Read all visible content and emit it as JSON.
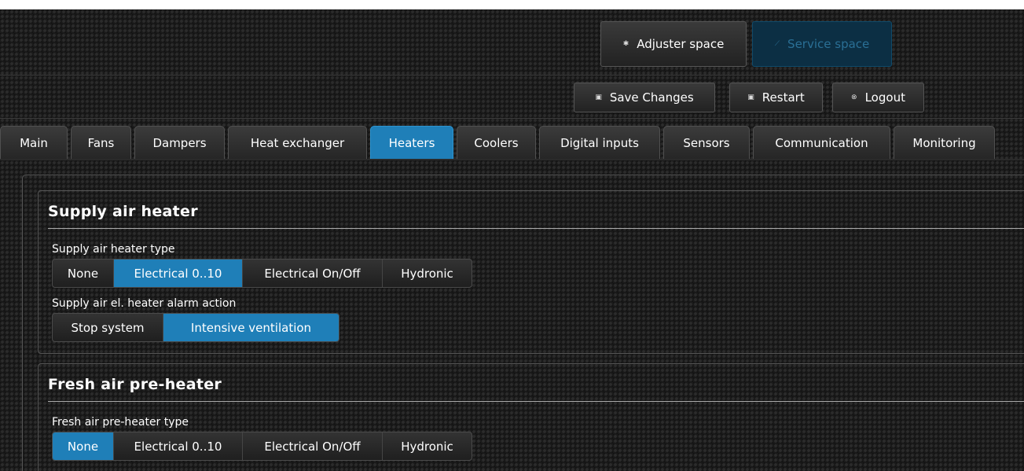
{
  "space_bar": {
    "adjuster": {
      "label": "Adjuster space",
      "icon": "gear-icon"
    },
    "service": {
      "label": "Service space",
      "icon": "wrench-icon"
    }
  },
  "actions": {
    "save": {
      "label": "Save Changes",
      "icon": "save-icon"
    },
    "restart": {
      "label": "Restart",
      "icon": "restart-icon"
    },
    "logout": {
      "label": "Logout",
      "icon": "logout-icon"
    }
  },
  "tabs": [
    {
      "label": "Main"
    },
    {
      "label": "Fans"
    },
    {
      "label": "Dampers"
    },
    {
      "label": "Heat exchanger"
    },
    {
      "label": "Heaters",
      "active": true
    },
    {
      "label": "Coolers"
    },
    {
      "label": "Digital inputs"
    },
    {
      "label": "Sensors"
    },
    {
      "label": "Communication"
    },
    {
      "label": "Monitoring"
    }
  ],
  "supply_heater": {
    "title": "Supply air heater",
    "type_label": "Supply air heater type",
    "type_options": [
      "None",
      "Electrical 0..10",
      "Electrical On/Off",
      "Hydronic"
    ],
    "type_selected": "Electrical 0..10",
    "alarm_label": "Supply air el. heater alarm action",
    "alarm_options": [
      "Stop system",
      "Intensive ventilation"
    ],
    "alarm_selected": "Intensive ventilation"
  },
  "preheater": {
    "title": "Fresh air pre-heater",
    "type_label": "Fresh air pre-heater type",
    "type_options": [
      "None",
      "Electrical 0..10",
      "Electrical On/Off",
      "Hydronic"
    ],
    "type_selected": "None"
  },
  "colors": {
    "accent": "#1f7fb8",
    "service_bg": "#0c2f44",
    "service_text": "#2a6f95",
    "background": "#1a1a1a"
  }
}
